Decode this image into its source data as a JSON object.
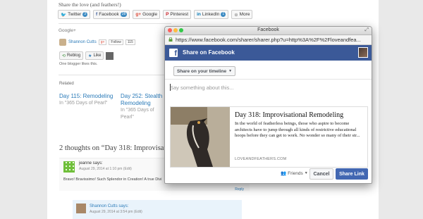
{
  "window": {
    "title": "Facebook",
    "url": "https://www.facebook.com/sharer/sharer.php?u=http%3A%2F%2Floveandfea..."
  },
  "share_section": {
    "title": "Share the love (and feathers!)",
    "buttons": [
      {
        "label": "Twitter",
        "count": "3"
      },
      {
        "label": "Facebook",
        "count": "28"
      },
      {
        "label": "Google"
      },
      {
        "label": "Pinterest"
      },
      {
        "label": "LinkedIn",
        "count": "1"
      },
      {
        "label": "More"
      }
    ]
  },
  "gplus": {
    "title": "Google+",
    "name": "Shannon Cutts",
    "follow": "Follow",
    "count": "115"
  },
  "actions": {
    "reblog": "Reblog",
    "like": "Like",
    "likes_text": "One blogger likes this."
  },
  "related": {
    "title": "Related",
    "items": [
      {
        "title": "Day 115: Remodeling",
        "sub": "In \"365 Days of Pearl\""
      },
      {
        "title": "Day 252: Stealth Remodeling",
        "sub": "In \"365 Days of Pearl\""
      }
    ]
  },
  "comments": {
    "heading": "2 thoughts on “Day 318: Improvisatio",
    "first": {
      "name": "jeanne says:",
      "date": "August 29, 2014 at 1:10 pm (Edit)",
      "text": "Bravo! Bravissimo! Such Splendor in Creation! A true Divi",
      "reply": "Reply"
    },
    "second": {
      "name": "Shannon Cutts says:",
      "date": "August 29, 2014 at 3:54 pm (Edit)"
    }
  },
  "fb": {
    "header": "Share on Facebook",
    "timeline": "Share on your timeline",
    "placeholder": "Say something about this...",
    "card": {
      "title": "Day 318: Improvisational Remodeling",
      "desc": "In the world of featherless beings, those who aspire to become architects have to jump through all kinds of restrictive educational hoops before they can get to work. No wonder so many of their str...",
      "domain": "LOVEANDFEATHERS.COM"
    },
    "audience": "Friends",
    "cancel": "Cancel",
    "share": "Share Link"
  }
}
